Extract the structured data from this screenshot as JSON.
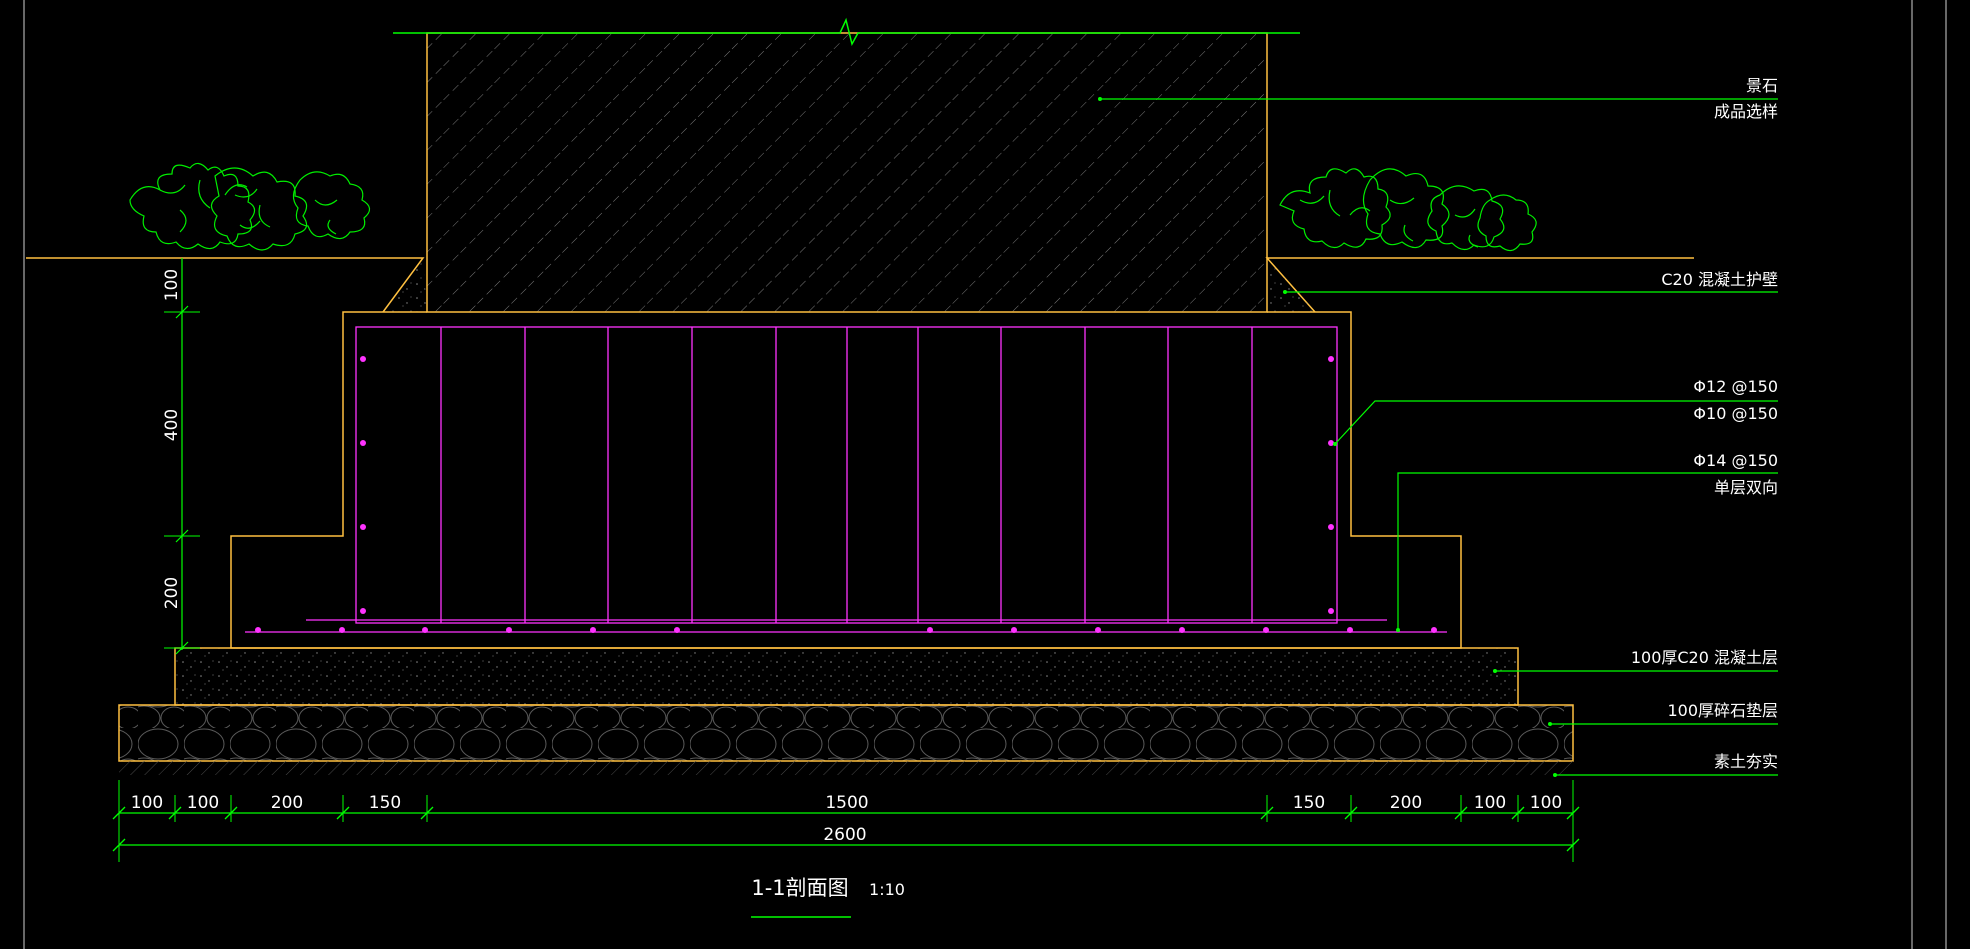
{
  "title": {
    "text": "1-1剖面图",
    "scale": "1:10"
  },
  "callouts": {
    "stone_1": "景石",
    "stone_2": "成品选样",
    "wall": "C20 混凝土护壁",
    "rebar_a": "Φ12 @150",
    "rebar_b": "Φ10 @150",
    "rebar_c": "Φ14 @150",
    "rebar_d": "单层双向",
    "concrete_layer": "100厚C20 混凝土层",
    "gravel_layer": "100厚碎石垫层",
    "soil": "素土夯实"
  },
  "dimensions": {
    "vertical": [
      "100",
      "400",
      "200"
    ],
    "horizontal": [
      "100",
      "100",
      "200",
      "150",
      "1500",
      "150",
      "200",
      "100",
      "100"
    ],
    "total": "2600"
  },
  "colors": {
    "background": "#000000",
    "outline": "#ffc040",
    "rebar": "#ff33ff",
    "leader": "#00ff00",
    "text": "#ffffff"
  }
}
